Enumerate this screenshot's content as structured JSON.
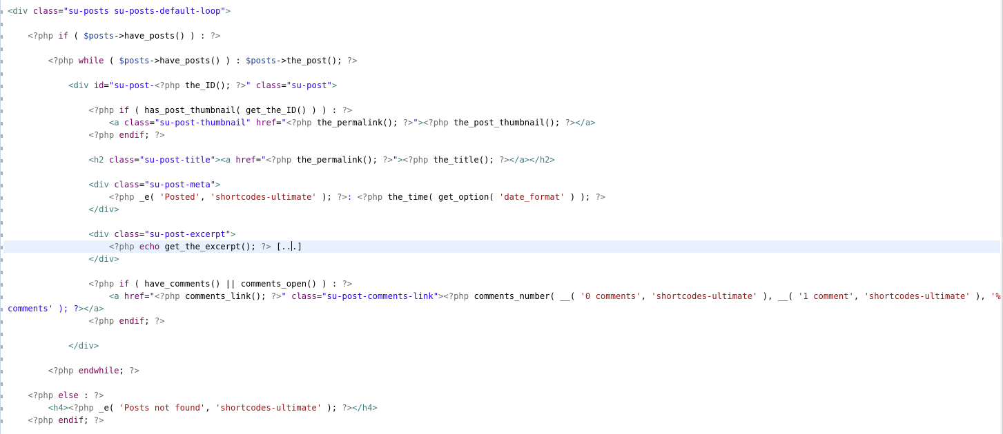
{
  "editor": {
    "current_line_index": 19,
    "lines": [
      "<div class=\"su-posts su-posts-default-loop\">",
      "",
      "    <?php if ( $posts->have_posts() ) : ?>",
      "",
      "        <?php while ( $posts->have_posts() ) : $posts->the_post(); ?>",
      "",
      "            <div id=\"su-post-<?php the_ID(); ?>\" class=\"su-post\">",
      "",
      "                <?php if ( has_post_thumbnail( get_the_ID() ) ) : ?>",
      "                    <a class=\"su-post-thumbnail\" href=\"<?php the_permalink(); ?>\"><?php the_post_thumbnail(); ?></a>",
      "                <?php endif; ?>",
      "",
      "                <h2 class=\"su-post-title\"><a href=\"<?php the_permalink(); ?>\"><?php the_title(); ?></a></h2>",
      "",
      "                <div class=\"su-post-meta\">",
      "                    <?php _e( 'Posted', 'shortcodes-ultimate' ); ?>: <?php the_time( get_option( 'date_format' ) ); ?>",
      "                </div>",
      "",
      "                <div class=\"su-post-excerpt\">",
      "                    <?php echo get_the_excerpt(); ?> [..|.]",
      "                </div>",
      "",
      "                <?php if ( have_comments() || comments_open() ) : ?>",
      "                    <a href=\"<?php comments_link(); ?>\" class=\"su-post-comments-link\"><?php comments_number( __( '0 comments', 'shortcodes-ultimate' ), __( '1 comment', 'shortcodes-ultimate' ), '%",
      "comments' ); ?></a>",
      "                <?php endif; ?>",
      "",
      "            </div>",
      "",
      "        <?php endwhile; ?>",
      "",
      "    <?php else : ?>",
      "        <h4><?php _e( 'Posts not found', 'shortcodes-ultimate' ); ?></h4>",
      "    <?php endif; ?>"
    ]
  },
  "colors": {
    "background": "#ffffff",
    "current_line": "#e8f2fe",
    "tag": "#3f7f7f",
    "attribute": "#7f007f",
    "string": "#2a00ff",
    "php_delim": "#6d6d6d",
    "keyword": "#7f0055",
    "variable": "#1d3f9e",
    "single_quote_string": "#a31515"
  }
}
